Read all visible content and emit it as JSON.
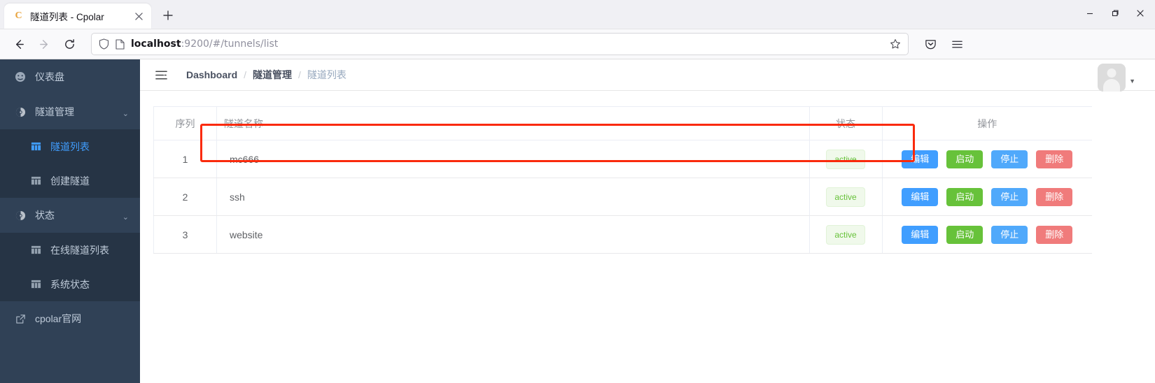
{
  "browser": {
    "tab": {
      "favicon_letter": "C",
      "title": "隧道列表 - Cpolar",
      "close_icon": "close-icon"
    },
    "new_tab_label": "+",
    "window_controls": {
      "minimize": "minimize-icon",
      "maximize": "maximize-icon",
      "close": "close-icon"
    },
    "nav": {
      "back": "back-arrow-icon",
      "forward": "forward-arrow-icon",
      "reload": "reload-icon"
    },
    "url": {
      "host": "localhost",
      "rest": ":9200/#/tunnels/list",
      "full": "localhost:9200/#/tunnels/list"
    },
    "url_icons": {
      "shield": "shield-icon",
      "page": "page-icon",
      "bookmark": "star-icon"
    },
    "toolbar_right": {
      "pocket": "pocket-icon",
      "menu": "hamburger-menu-icon"
    }
  },
  "sidebar": {
    "items": [
      {
        "label": "仪表盘",
        "icon": "dashboard-icon",
        "type": "item"
      },
      {
        "label": "隧道管理",
        "icon": "tunnel-icon",
        "type": "group",
        "arrow": "⌃",
        "children": [
          {
            "label": "隧道列表",
            "icon": "table-icon",
            "active": true
          },
          {
            "label": "创建隧道",
            "icon": "table-icon",
            "active": false
          }
        ]
      },
      {
        "label": "状态",
        "icon": "status-icon",
        "type": "group",
        "arrow": "⌃",
        "children": [
          {
            "label": "在线隧道列表",
            "icon": "table-icon",
            "active": false
          },
          {
            "label": "系统状态",
            "icon": "table-icon",
            "active": false
          }
        ]
      },
      {
        "label": "cpolar官网",
        "icon": "external-link-icon",
        "type": "link"
      }
    ]
  },
  "topbar": {
    "hamburger_icon": "collapse-menu-icon",
    "breadcrumb": [
      {
        "label": "Dashboard",
        "last": false
      },
      {
        "label": "隧道管理",
        "last": false
      },
      {
        "label": "隧道列表",
        "last": true
      }
    ],
    "separator": "/",
    "avatar": "user-avatar",
    "caret": "▼"
  },
  "table": {
    "headers": {
      "index": "序列",
      "name": "隧道名称",
      "status": "状态",
      "action": "操作"
    },
    "rows": [
      {
        "index": "1",
        "name": "mc666",
        "status": "active",
        "highlighted": true
      },
      {
        "index": "2",
        "name": "ssh",
        "status": "active",
        "highlighted": false
      },
      {
        "index": "3",
        "name": "website",
        "status": "active",
        "highlighted": false
      }
    ],
    "actions": {
      "edit": "编辑",
      "start": "启动",
      "stop": "停止",
      "delete": "删除"
    },
    "colors": {
      "edit": "#409eff",
      "start": "#67c23a",
      "stop": "#50a9fb",
      "delete": "#f07b7b",
      "badge_text": "#67c23a",
      "badge_bg": "#f0f9eb",
      "highlight": "#fa2a0c",
      "sidebar_bg": "#304156",
      "sidebar_submenu_bg": "#263445",
      "sidebar_active": "#409eff"
    }
  }
}
